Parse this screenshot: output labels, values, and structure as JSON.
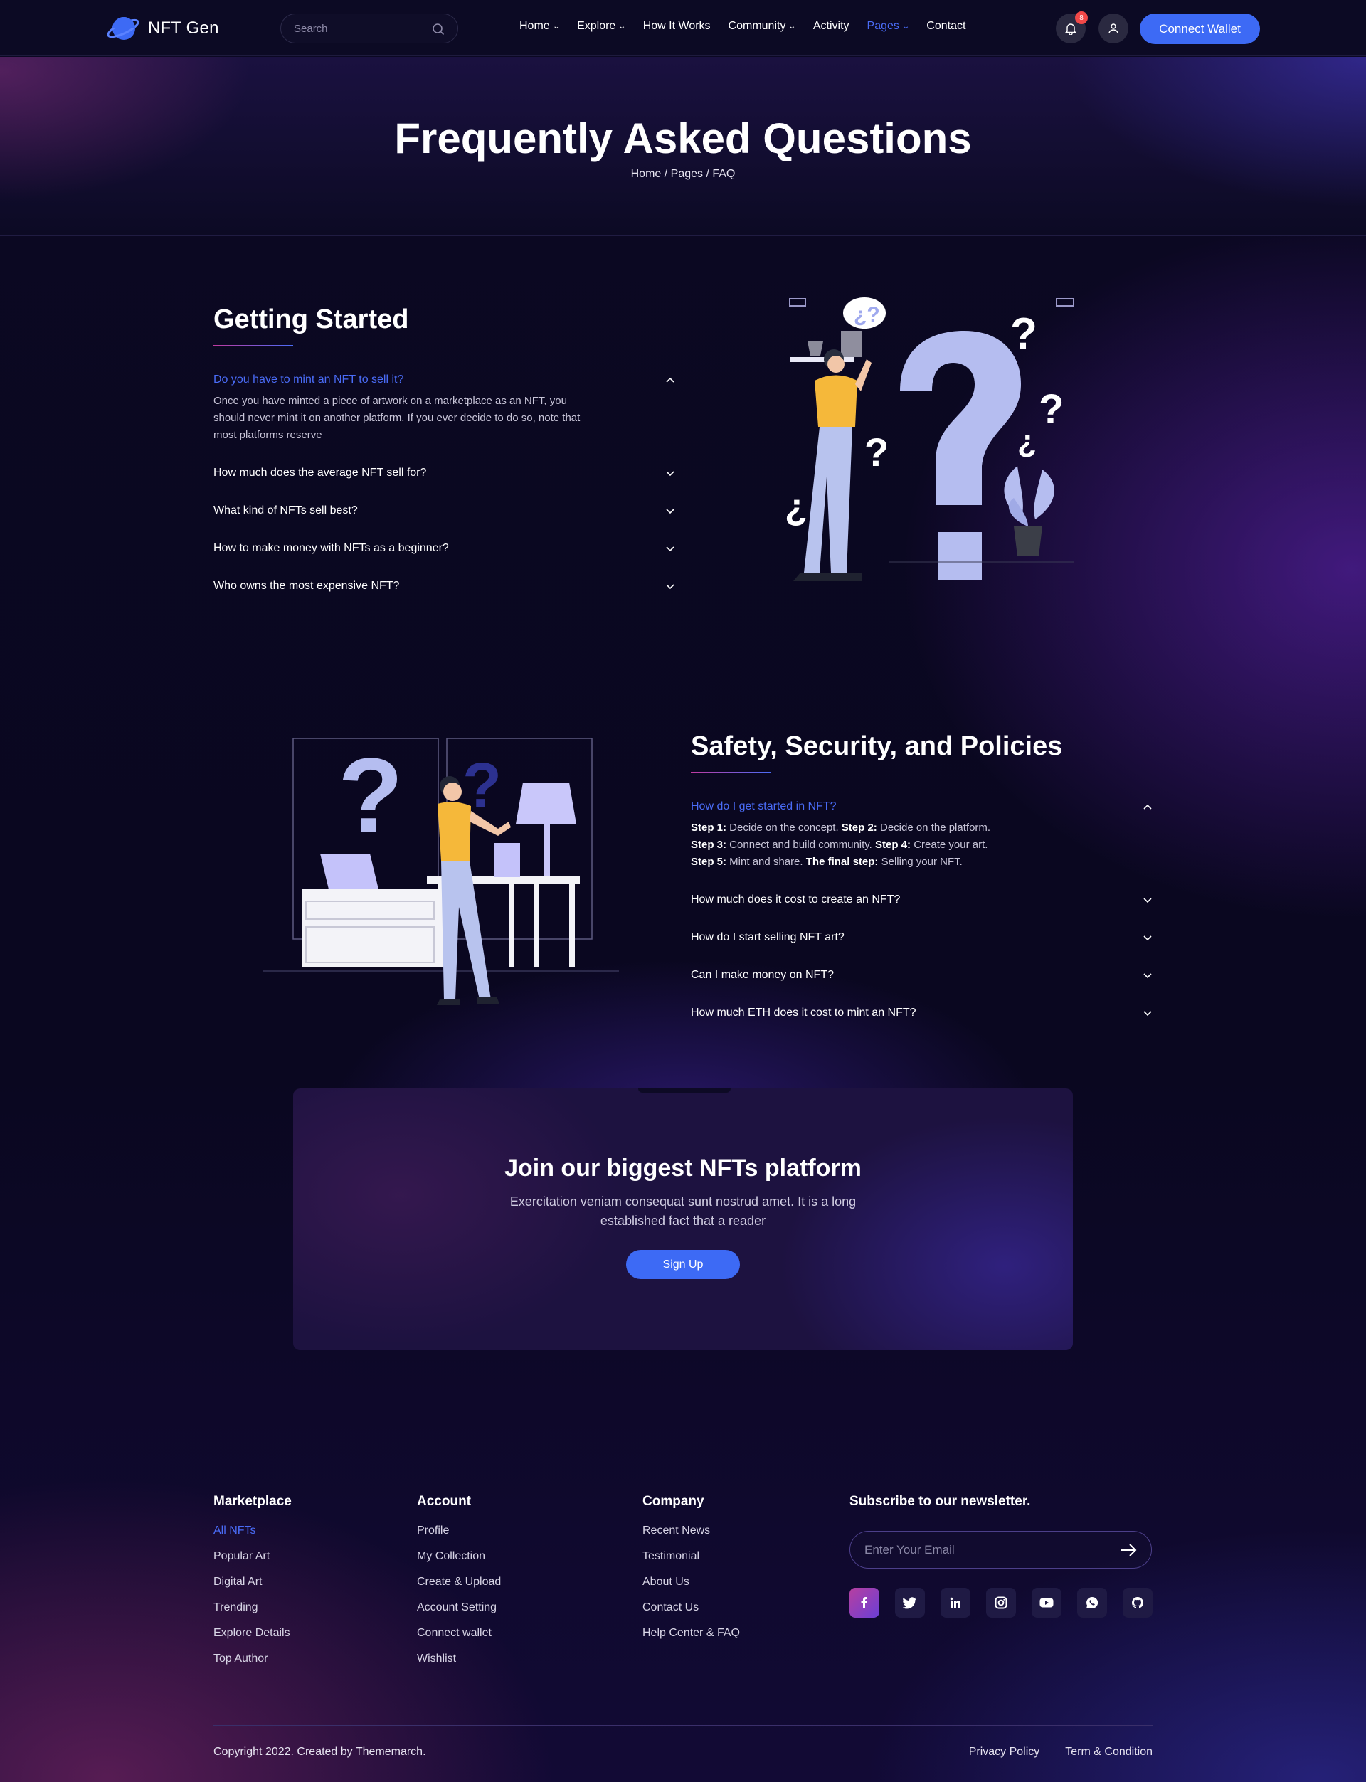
{
  "header": {
    "logo_text": "NFT Gen",
    "search_placeholder": "Search",
    "nav": [
      {
        "label": "Home",
        "dropdown": true
      },
      {
        "label": "Explore",
        "dropdown": true
      },
      {
        "label": "How It Works",
        "dropdown": false
      },
      {
        "label": "Community",
        "dropdown": true
      },
      {
        "label": "Activity",
        "dropdown": false
      },
      {
        "label": "Pages",
        "dropdown": true,
        "active": true
      },
      {
        "label": "Contact",
        "dropdown": false
      }
    ],
    "notification_count": "8",
    "connect_label": "Connect Wallet"
  },
  "hero": {
    "title": "Frequently Asked Questions",
    "breadcrumb": "Home / Pages / FAQ"
  },
  "getting_started": {
    "title": "Getting Started",
    "items": [
      {
        "q": "Do you have to mint an NFT to sell it?",
        "a": "Once you have minted a piece of artwork on a marketplace as an NFT, you should never mint it on another platform. If you ever decide to do so, note that most platforms reserve"
      },
      {
        "q": "How much does the average NFT sell for?"
      },
      {
        "q": "What kind of NFTs sell best?"
      },
      {
        "q": "How to make money with NFTs as a beginner?"
      },
      {
        "q": "Who owns the most expensive NFT?"
      }
    ]
  },
  "safety": {
    "title": "Safety, Security, and Policies",
    "items": [
      {
        "q": "How do I get started in NFT?"
      },
      {
        "q": "How much does it cost to create an NFT?"
      },
      {
        "q": "How do I start selling NFT art?"
      },
      {
        "q": "Can I make money on NFT?"
      },
      {
        "q": "How much ETH does it cost to mint an NFT?"
      }
    ],
    "answer_steps": {
      "s1_label": "Step 1:",
      "s1_text": " Decide on the concept. ",
      "s2_label": "Step 2:",
      "s2_text": " Decide on the platform.",
      "s3_label": "Step 3:",
      "s3_text": " Connect and build community. ",
      "s4_label": "Step 4:",
      "s4_text": " Create your art.",
      "s5_label": "Step 5:",
      "s5_text": " Mint and share. ",
      "final_label": "The final step:",
      "final_text": " Selling your NFT."
    }
  },
  "cta": {
    "title": "Join our biggest NFTs platform",
    "text": "Exercitation veniam consequat sunt nostrud amet. It is a long established fact that a reader",
    "button": "Sign Up"
  },
  "footer": {
    "marketplace": {
      "title": "Marketplace",
      "links": [
        "All NFTs",
        "Popular Art",
        "Digital Art",
        "Trending",
        "Explore Details",
        "Top Author"
      ]
    },
    "account": {
      "title": "Account",
      "links": [
        "Profile",
        "My Collection",
        "Create & Upload",
        "Account Setting",
        "Connect wallet",
        "Wishlist"
      ]
    },
    "company": {
      "title": "Company",
      "links": [
        "Recent News",
        "Testimonial",
        "About Us",
        "Contact Us",
        "Help Center & FAQ"
      ]
    },
    "newsletter": {
      "title": "Subscribe to our newsletter.",
      "placeholder": "Enter Your Email"
    },
    "socials": [
      "facebook-icon",
      "twitter-icon",
      "linkedin-icon",
      "instagram-icon",
      "youtube-icon",
      "whatsapp-icon",
      "github-icon"
    ],
    "copyright": "Copyright 2022. Created by Thememarch.",
    "legal": [
      "Privacy Policy",
      "Term & Condition"
    ]
  },
  "colors": {
    "accent": "#3d6af5",
    "link_active": "#4a6cf7",
    "background": "#0a0720"
  }
}
